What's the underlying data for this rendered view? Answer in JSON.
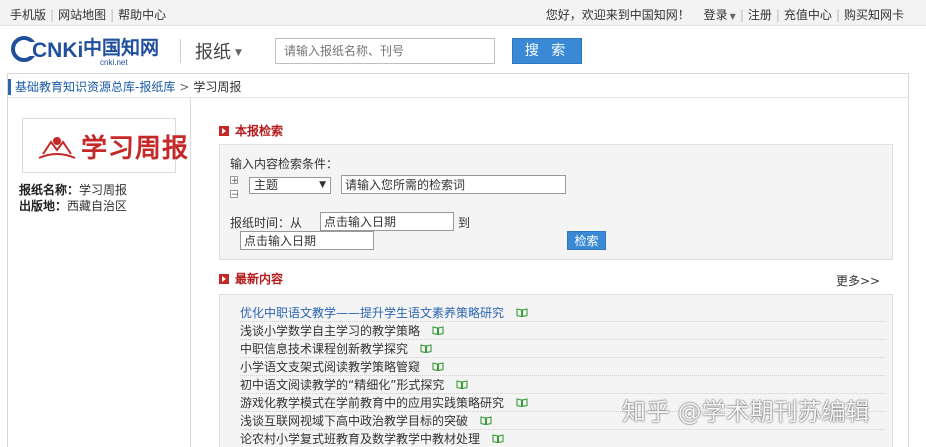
{
  "topbar": {
    "left_links": [
      "手机版",
      "网站地图",
      "帮助中心"
    ],
    "welcome": "您好，欢迎来到中国知网！",
    "login": "登录",
    "register": "注册",
    "recharge": "充值中心",
    "buy_card": "购买知网卡"
  },
  "header": {
    "logo_main": "CNKi",
    "logo_cn": "中国知网",
    "logo_sub": "cnki.net",
    "section": "报纸",
    "search_placeholder": "请输入报纸名称、刊号",
    "search_button": "搜 索"
  },
  "breadcrumb": {
    "library": "基础教育知识资源总库-报纸库",
    "arrow": ">",
    "current": "学习周报"
  },
  "paper": {
    "logo_text": "学习周报",
    "name_label": "报纸名称：",
    "name_value": "学习周报",
    "location_label": "出版地：",
    "location_value": "西藏自治区"
  },
  "search_section": {
    "title": "本报检索",
    "condition_label": "输入内容检索条件：",
    "plus": "+",
    "minus": "−",
    "field_selected": "主题",
    "keyword_value": "请输入您所需的检索词",
    "time_label": "报纸时间：从",
    "from_value": "点击输入日期",
    "to_label": "到",
    "to_value": "点击输入日期",
    "button": "检索"
  },
  "latest": {
    "title": "最新内容",
    "more": "更多>>",
    "items": [
      "优化中职语文教学——提升学生语文素养策略研究",
      "浅谈小学数学自主学习的教学策略",
      "中职信息技术课程创新教学探究",
      "小学语文支架式阅读教学策略管窥",
      "初中语文阅读教学的“精细化”形式探究",
      "游戏化教学模式在学前教育中的应用实践策略研究",
      "浅谈互联网视域下高中政治教学目标的突破",
      "论农村小学复式班教育及数学教学中教材处理"
    ]
  },
  "watermark": "知乎 @学术期刊苏编辑",
  "colors": {
    "accent_blue": "#3a89d6",
    "link_blue": "#2a65b0",
    "section_red": "#c62828",
    "book_icon_green": "#3a9a3a"
  }
}
